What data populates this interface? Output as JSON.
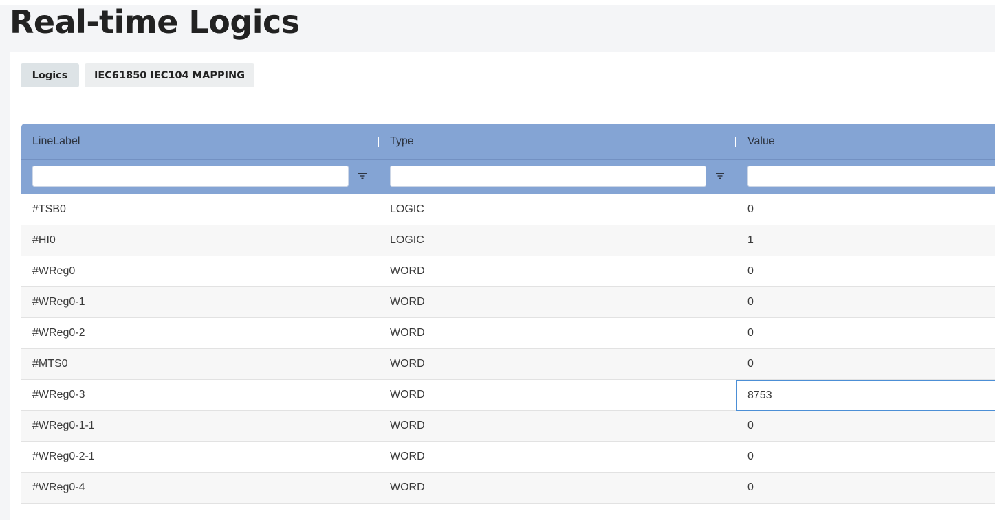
{
  "page": {
    "title": "Real-time Logics"
  },
  "tabs": [
    {
      "label": "Logics",
      "active": true
    },
    {
      "label": "IEC61850 IEC104 MAPPING",
      "active": false
    }
  ],
  "grid": {
    "columns": [
      {
        "header": "LineLabel",
        "filter_value": "",
        "filter_icon": "filter-icon"
      },
      {
        "header": "Type",
        "filter_value": "",
        "filter_icon": "filter-icon"
      },
      {
        "header": "Value",
        "filter_value": ""
      }
    ],
    "rows": [
      {
        "label": "#TSB0",
        "type": "LOGIC",
        "value": "0"
      },
      {
        "label": "#HI0",
        "type": "LOGIC",
        "value": "1"
      },
      {
        "label": "#WReg0",
        "type": "WORD",
        "value": "0"
      },
      {
        "label": "#WReg0-1",
        "type": "WORD",
        "value": "0"
      },
      {
        "label": "#WReg0-2",
        "type": "WORD",
        "value": "0"
      },
      {
        "label": "#MTS0",
        "type": "WORD",
        "value": "0"
      },
      {
        "label": "#WReg0-3",
        "type": "WORD",
        "value": "8753",
        "focused": true
      },
      {
        "label": "#WReg0-1-1",
        "type": "WORD",
        "value": "0"
      },
      {
        "label": "#WReg0-2-1",
        "type": "WORD",
        "value": "0"
      },
      {
        "label": "#WReg0-4",
        "type": "WORD",
        "value": "0"
      }
    ]
  },
  "colors": {
    "header_bg": "#84a4d4",
    "focus_border": "#4c8fd6",
    "active_tab_bg": "#dde3e6"
  }
}
